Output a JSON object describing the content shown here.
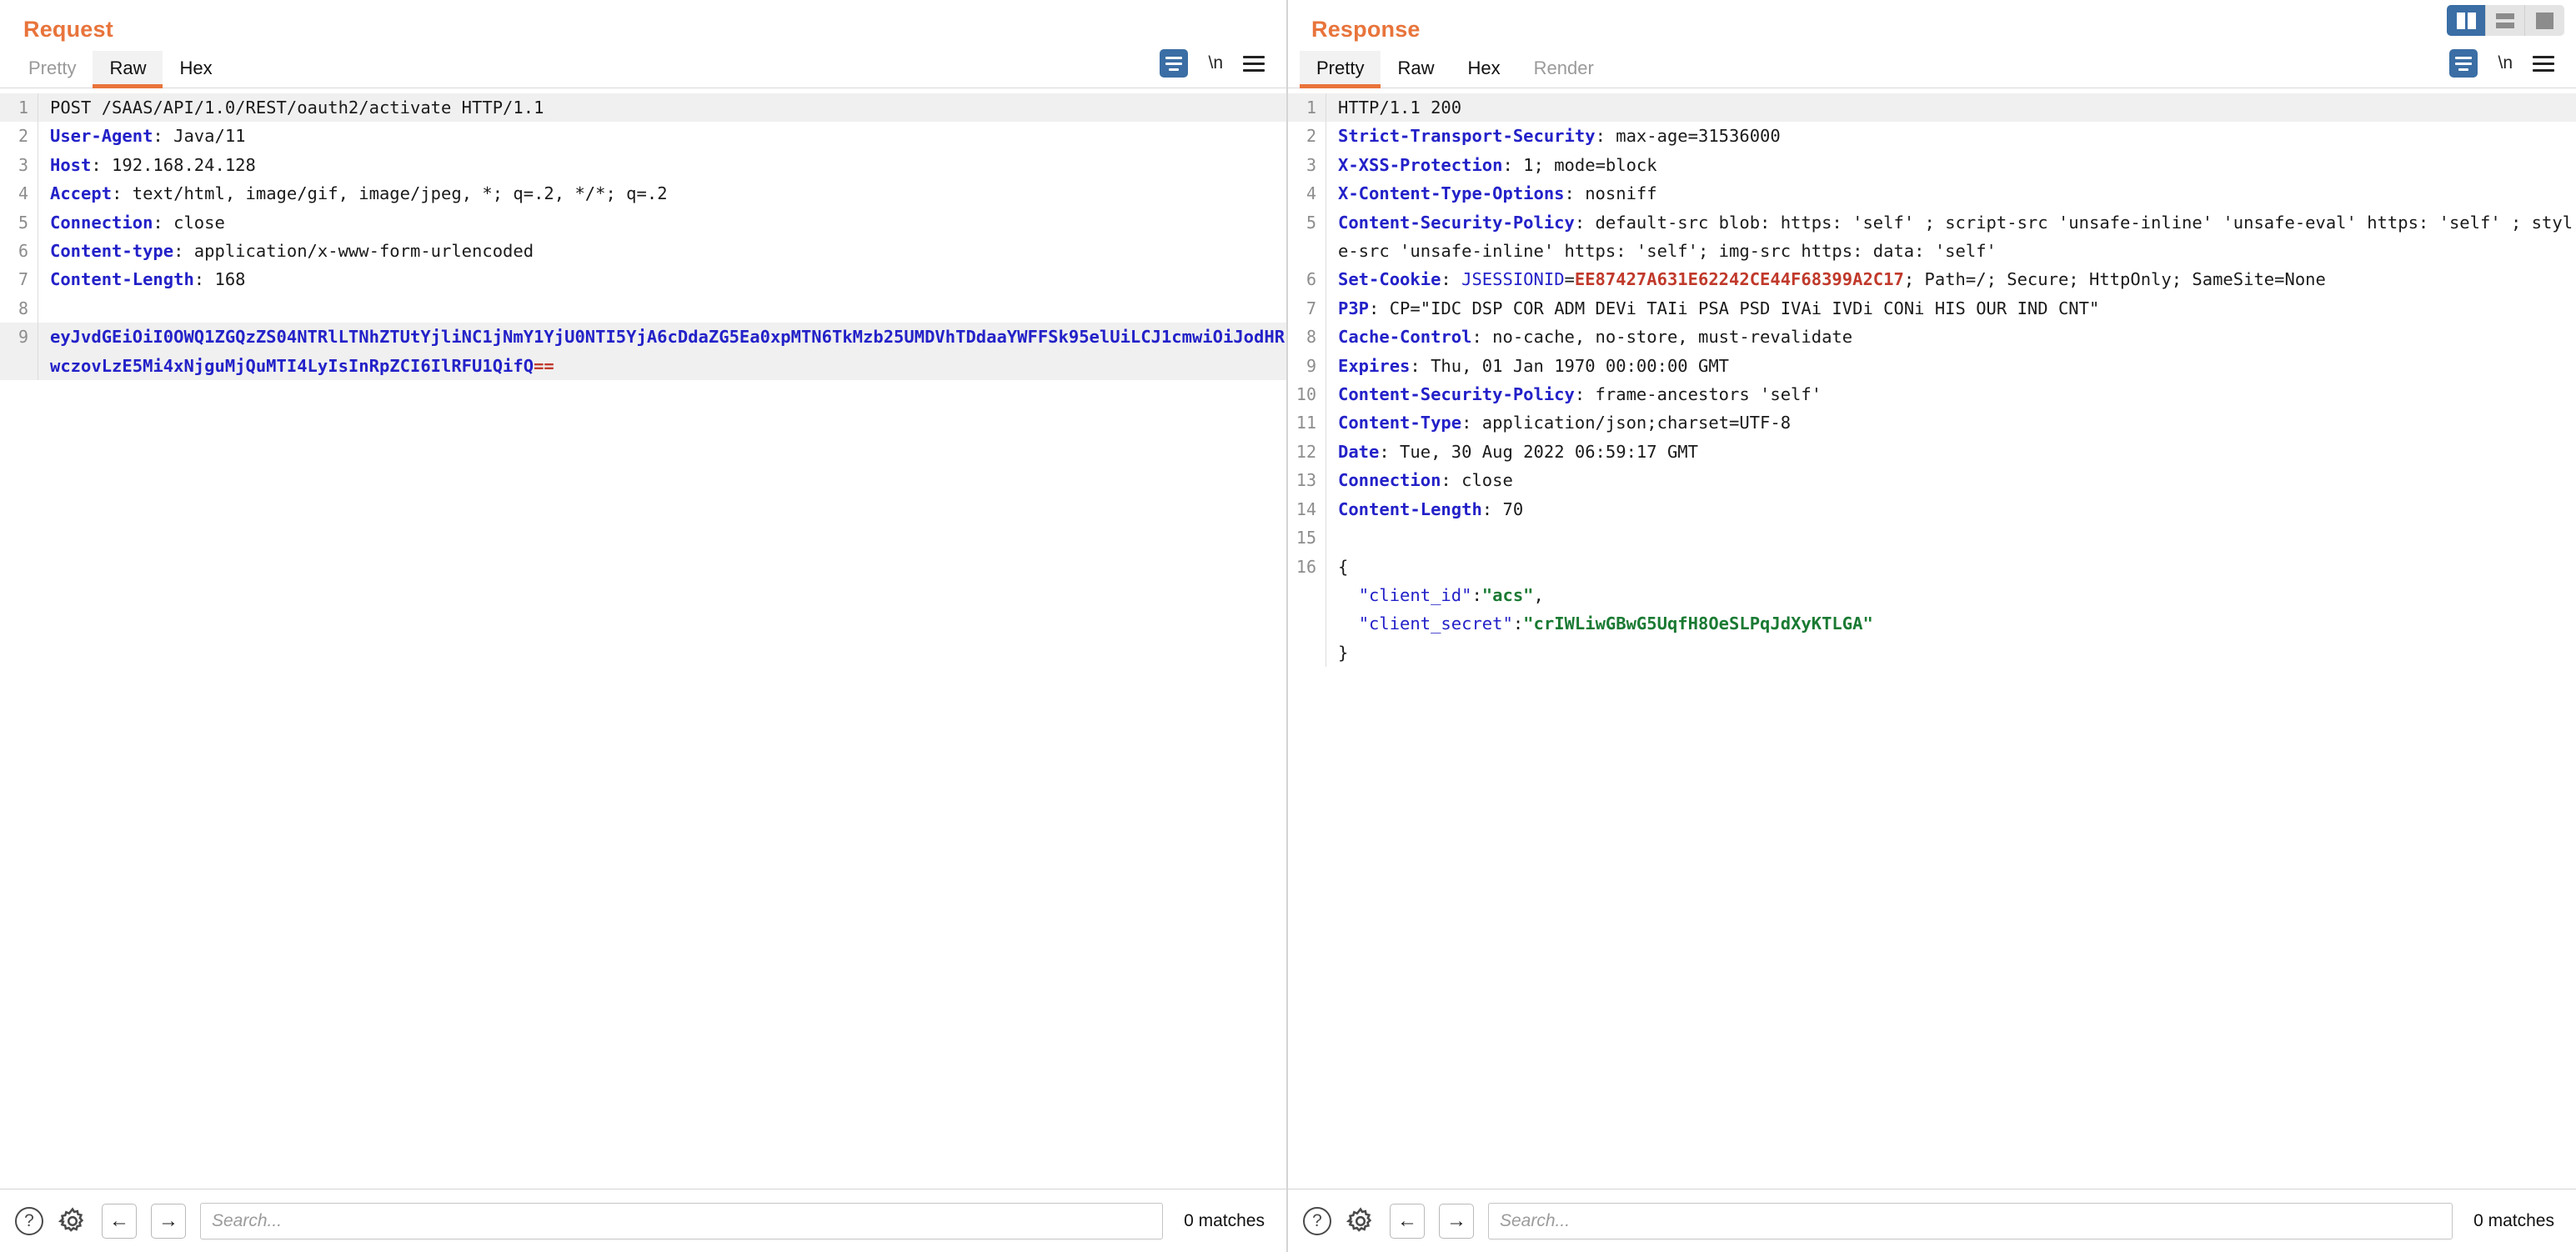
{
  "window": {
    "view_toggle": [
      {
        "name": "split-vertical",
        "active": true
      },
      {
        "name": "split-horizontal",
        "active": false
      },
      {
        "name": "single-pane",
        "active": false
      }
    ]
  },
  "request": {
    "title": "Request",
    "tabs": [
      {
        "label": "Pretty",
        "active": false,
        "muted": true
      },
      {
        "label": "Raw",
        "active": true,
        "muted": false
      },
      {
        "label": "Hex",
        "active": false,
        "muted": false
      }
    ],
    "actions": {
      "wrap_icon": "word-wrap-icon",
      "newline_label": "\\n",
      "menu_icon": "hamburger-menu-icon"
    },
    "lines": [
      {
        "n": "1",
        "highlight": true,
        "parts": [
          {
            "t": "POST /SAAS/API/1.0/REST/oauth2/activate HTTP/1.1",
            "c": "val"
          }
        ]
      },
      {
        "n": "2",
        "highlight": false,
        "parts": [
          {
            "t": "User-Agent",
            "c": "hdr"
          },
          {
            "t": ": Java/11",
            "c": "val"
          }
        ]
      },
      {
        "n": "3",
        "highlight": false,
        "parts": [
          {
            "t": "Host",
            "c": "hdr"
          },
          {
            "t": ": 192.168.24.128",
            "c": "val"
          }
        ]
      },
      {
        "n": "4",
        "highlight": false,
        "parts": [
          {
            "t": "Accept",
            "c": "hdr"
          },
          {
            "t": ": text/html, image/gif, image/jpeg, *; q=.2, */*; q=.2",
            "c": "val"
          }
        ]
      },
      {
        "n": "5",
        "highlight": false,
        "parts": [
          {
            "t": "Connection",
            "c": "hdr"
          },
          {
            "t": ": close",
            "c": "val"
          }
        ]
      },
      {
        "n": "6",
        "highlight": false,
        "parts": [
          {
            "t": "Content-type",
            "c": "hdr"
          },
          {
            "t": ": application/x-www-form-urlencoded",
            "c": "val"
          }
        ]
      },
      {
        "n": "7",
        "highlight": false,
        "parts": [
          {
            "t": "Content-Length",
            "c": "hdr"
          },
          {
            "t": ": 168",
            "c": "val"
          }
        ]
      },
      {
        "n": "8",
        "highlight": false,
        "parts": [
          {
            "t": "",
            "c": "val"
          }
        ]
      },
      {
        "n": "9",
        "highlight": true,
        "parts": [
          {
            "t": "eyJvdGEiOiI0OWQ1ZGQzZS04NTRlLTNhZTUtYjliNC1jNmY1YjU0NTI5YjA6cDdaZG5Ea0xpMTN6TkMzb25UMDVhTDdaaYWFFSk95elUiLCJ1cmwiOiJodHRwczovLzE5Mi4xNjguMjQuMTI4LyIsInRpZCI6IlRFU1QifQ",
            "c": "b64"
          },
          {
            "t": "==",
            "c": "red"
          }
        ]
      }
    ],
    "search": {
      "placeholder": "Search...",
      "value": "",
      "matches": "0 matches",
      "help_icon": "question-mark-icon",
      "settings_icon": "gear-icon",
      "prev_icon": "arrow-left-icon",
      "next_icon": "arrow-right-icon"
    }
  },
  "response": {
    "title": "Response",
    "tabs": [
      {
        "label": "Pretty",
        "active": true,
        "muted": false
      },
      {
        "label": "Raw",
        "active": false,
        "muted": false
      },
      {
        "label": "Hex",
        "active": false,
        "muted": false
      },
      {
        "label": "Render",
        "active": false,
        "muted": true
      }
    ],
    "actions": {
      "wrap_icon": "word-wrap-icon",
      "newline_label": "\\n",
      "menu_icon": "hamburger-menu-icon"
    },
    "lines": [
      {
        "n": "1",
        "highlight": true,
        "parts": [
          {
            "t": "HTTP/1.1 200",
            "c": "val"
          }
        ]
      },
      {
        "n": "2",
        "highlight": false,
        "parts": [
          {
            "t": "Strict-Transport-Security",
            "c": "hdr"
          },
          {
            "t": ": max-age=31536000",
            "c": "val"
          }
        ]
      },
      {
        "n": "3",
        "highlight": false,
        "parts": [
          {
            "t": "X-XSS-Protection",
            "c": "hdr"
          },
          {
            "t": ": 1; mode=block",
            "c": "val"
          }
        ]
      },
      {
        "n": "4",
        "highlight": false,
        "parts": [
          {
            "t": "X-Content-Type-Options",
            "c": "hdr"
          },
          {
            "t": ": nosniff",
            "c": "val"
          }
        ]
      },
      {
        "n": "5",
        "highlight": false,
        "parts": [
          {
            "t": "Content-Security-Policy",
            "c": "hdr"
          },
          {
            "t": ": default-src blob: https: 'self' ; script-src 'unsafe-inline' 'unsafe-eval' https: 'self' ; style-src 'unsafe-inline' https: 'self'; img-src https: data: 'self'",
            "c": "val"
          }
        ]
      },
      {
        "n": "6",
        "highlight": false,
        "parts": [
          {
            "t": "Set-Cookie",
            "c": "hdr"
          },
          {
            "t": ": ",
            "c": "val"
          },
          {
            "t": "JSESSIONID",
            "c": "blu"
          },
          {
            "t": "=",
            "c": "val"
          },
          {
            "t": "EE87427A631E62242CE44F68399A2C17",
            "c": "red"
          },
          {
            "t": "; Path=/; Secure; HttpOnly; SameSite=None",
            "c": "val"
          }
        ]
      },
      {
        "n": "7",
        "highlight": false,
        "parts": [
          {
            "t": "P3P",
            "c": "hdr"
          },
          {
            "t": ": CP=\"IDC DSP COR ADM DEVi TAIi PSA PSD IVAi IVDi CONi HIS OUR IND CNT\"",
            "c": "val"
          }
        ]
      },
      {
        "n": "8",
        "highlight": false,
        "parts": [
          {
            "t": "Cache-Control",
            "c": "hdr"
          },
          {
            "t": ": no-cache, no-store, must-revalidate",
            "c": "val"
          }
        ]
      },
      {
        "n": "9",
        "highlight": false,
        "parts": [
          {
            "t": "Expires",
            "c": "hdr"
          },
          {
            "t": ": Thu, 01 Jan 1970 00:00:00 GMT",
            "c": "val"
          }
        ]
      },
      {
        "n": "10",
        "highlight": false,
        "parts": [
          {
            "t": "Content-Security-Policy",
            "c": "hdr"
          },
          {
            "t": ": frame-ancestors 'self'",
            "c": "val"
          }
        ]
      },
      {
        "n": "11",
        "highlight": false,
        "parts": [
          {
            "t": "Content-Type",
            "c": "hdr"
          },
          {
            "t": ": application/json;charset=UTF-8",
            "c": "val"
          }
        ]
      },
      {
        "n": "12",
        "highlight": false,
        "parts": [
          {
            "t": "Date",
            "c": "hdr"
          },
          {
            "t": ": Tue, 30 Aug 2022 06:59:17 GMT",
            "c": "val"
          }
        ]
      },
      {
        "n": "13",
        "highlight": false,
        "parts": [
          {
            "t": "Connection",
            "c": "hdr"
          },
          {
            "t": ": close",
            "c": "val"
          }
        ]
      },
      {
        "n": "14",
        "highlight": false,
        "parts": [
          {
            "t": "Content-Length",
            "c": "hdr"
          },
          {
            "t": ": 70",
            "c": "val"
          }
        ]
      },
      {
        "n": "15",
        "highlight": false,
        "parts": [
          {
            "t": "",
            "c": "val"
          }
        ]
      },
      {
        "n": "16",
        "highlight": false,
        "parts": [
          {
            "t": "{",
            "c": "val"
          }
        ]
      },
      {
        "n": "",
        "highlight": false,
        "parts": [
          {
            "t": "  ",
            "c": "val"
          },
          {
            "t": "\"client_id\"",
            "c": "blu"
          },
          {
            "t": ":",
            "c": "val"
          },
          {
            "t": "\"acs\"",
            "c": "grn"
          },
          {
            "t": ",",
            "c": "val"
          }
        ]
      },
      {
        "n": "",
        "highlight": false,
        "parts": [
          {
            "t": "  ",
            "c": "val"
          },
          {
            "t": "\"client_secret\"",
            "c": "blu"
          },
          {
            "t": ":",
            "c": "val"
          },
          {
            "t": "\"crIWLiwGBwG5UqfH8OeSLPqJdXyKTLGA\"",
            "c": "grn"
          }
        ]
      },
      {
        "n": "",
        "highlight": false,
        "parts": [
          {
            "t": "}",
            "c": "val"
          }
        ]
      }
    ],
    "search": {
      "placeholder": "Search...",
      "value": "",
      "matches": "0 matches",
      "help_icon": "question-mark-icon",
      "settings_icon": "gear-icon",
      "prev_icon": "arrow-left-icon",
      "next_icon": "arrow-right-icon"
    }
  },
  "colors": {
    "accent_orange": "#e8743b",
    "header_blue": "#2321c8",
    "value_red": "#c0392b",
    "string_green": "#1a7a33",
    "toggle_blue": "#3a6ea5"
  }
}
